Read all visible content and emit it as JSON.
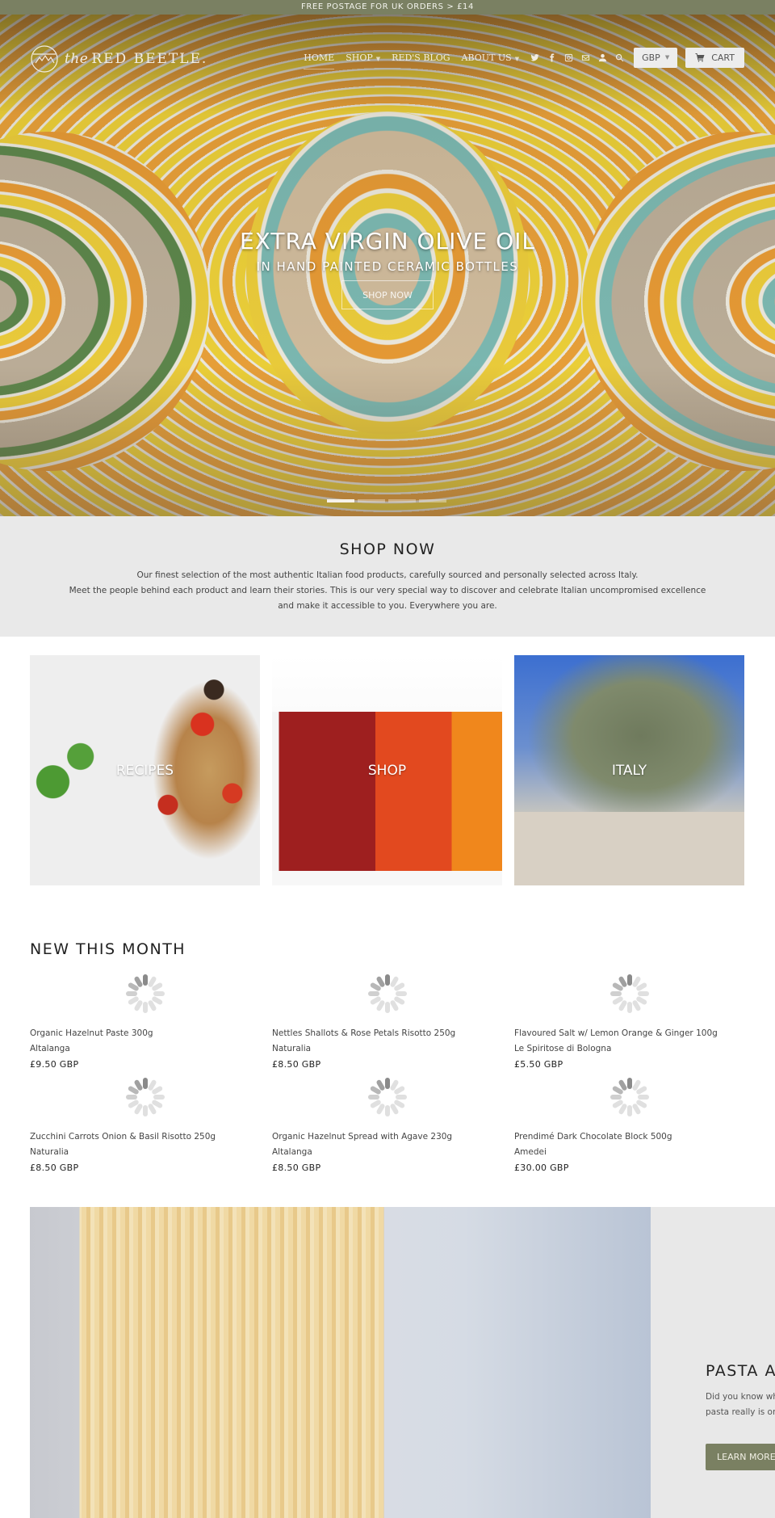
{
  "announcement": "FREE POSTAGE FOR UK ORDERS > £14",
  "brand": {
    "prefix": "the",
    "name": "RED BEETLE."
  },
  "nav": {
    "items": [
      {
        "label": "HOME",
        "active": true,
        "dropdown": false
      },
      {
        "label": "SHOP",
        "active": false,
        "dropdown": true
      },
      {
        "label": "RED'S BLOG",
        "active": false,
        "dropdown": false
      },
      {
        "label": "ABOUT US",
        "active": false,
        "dropdown": true
      }
    ],
    "social_icons": [
      "twitter-icon",
      "facebook-icon",
      "instagram-icon",
      "email-icon",
      "account-icon",
      "search-icon"
    ],
    "currency": "GBP",
    "cart_label": "CART"
  },
  "hero": {
    "title": "EXTRA VIRGIN OLIVE OIL",
    "subtitle": "IN HAND PAINTED CERAMIC BOTTLES",
    "button": "SHOP NOW",
    "slides": 4,
    "active_slide": 1
  },
  "shop_now": {
    "heading": "SHOP NOW",
    "lines": [
      "Our finest selection of the most authentic Italian food products, carefully sourced and personally selected across Italy.",
      "Meet the people behind each product and learn their stories. This is our very special way to discover and celebrate Italian uncompromised excellence",
      "and make it accessible to you. Everywhere you are."
    ]
  },
  "categories": [
    {
      "label": "RECIPES"
    },
    {
      "label": "SHOP"
    },
    {
      "label": "ITALY"
    }
  ],
  "new_this_month": {
    "heading": "NEW THIS MONTH",
    "products": [
      {
        "title": "Organic Hazelnut Paste 300g",
        "vendor": "Altalanga",
        "price": "£9.50 GBP"
      },
      {
        "title": "Nettles Shallots & Rose Petals Risotto 250g",
        "vendor": "Naturalia",
        "price": "£8.50 GBP"
      },
      {
        "title": "Flavoured Salt w/ Lemon Orange & Ginger 100g",
        "vendor": "Le Spiritose di Bologna",
        "price": "£5.50 GBP"
      },
      {
        "title": "Zucchini Carrots Onion & Basil Risotto 250g",
        "vendor": "Naturalia",
        "price": "£8.50 GBP"
      },
      {
        "title": "Organic Hazelnut Spread with Agave 230g",
        "vendor": "Altalanga",
        "price": "£8.50 GBP"
      },
      {
        "title": "Prendimé Dark Chocolate Block 500g",
        "vendor": "Amedei",
        "price": "£30.00 GBP"
      }
    ]
  },
  "feature": {
    "heading": "PASTA AT",
    "lines": [
      "Did you know wh",
      "pasta really is on"
    ],
    "button": "LEARN MORE"
  },
  "colors": {
    "brand_olive": "#7a8062",
    "section_gray": "#e9e9e9"
  }
}
